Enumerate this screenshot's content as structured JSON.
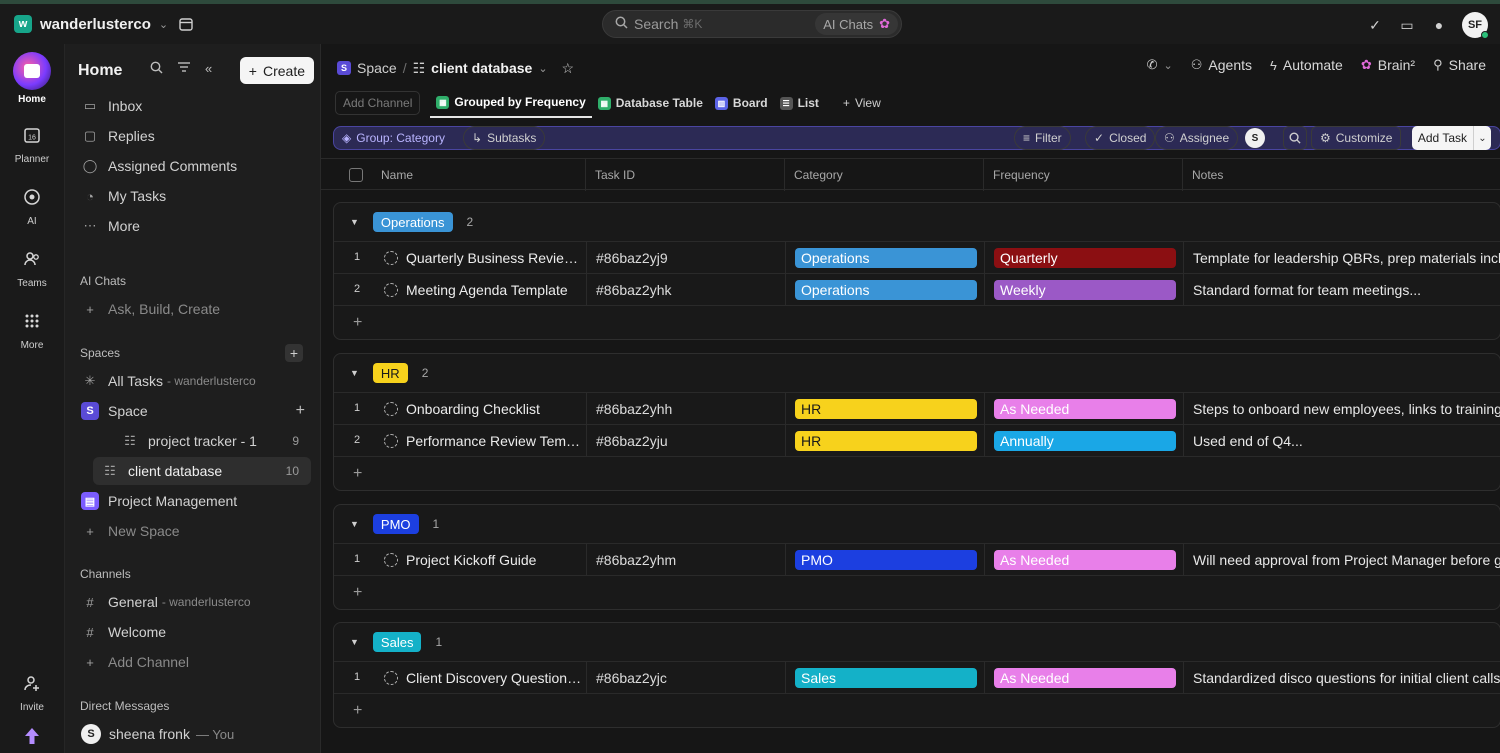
{
  "workspace": {
    "initial": "w",
    "name": "wanderlusterco"
  },
  "search": {
    "label": "Search",
    "hint": "⌘K",
    "ai_chats": "AI Chats"
  },
  "user": {
    "initials": "SF"
  },
  "rail": [
    {
      "label": "Home",
      "icon": "home-icon"
    },
    {
      "label": "Planner",
      "icon": "calendar-icon"
    },
    {
      "label": "AI",
      "icon": "ai-icon"
    },
    {
      "label": "Teams",
      "icon": "teams-icon"
    },
    {
      "label": "More",
      "icon": "grid-icon"
    }
  ],
  "rail_bottom": {
    "invite": "Invite"
  },
  "sidebar": {
    "title": "Home",
    "create": "Create",
    "nav": [
      {
        "label": "Inbox",
        "icon": "inbox-icon"
      },
      {
        "label": "Replies",
        "icon": "replies-icon"
      },
      {
        "label": "Assigned Comments",
        "icon": "comments-icon"
      },
      {
        "label": "My Tasks",
        "icon": "user-icon"
      },
      {
        "label": "More",
        "icon": "ellipsis-icon"
      }
    ],
    "ai_chats_title": "AI Chats",
    "ai_chats_prompt": "Ask, Build, Create",
    "spaces_title": "Spaces",
    "spaces": {
      "all_tasks": "All Tasks",
      "all_tasks_sub": "- wanderlusterco",
      "space": "Space",
      "space_initial": "S",
      "project_tracker": "project tracker - 1",
      "project_tracker_count": "9",
      "client_database": "client database",
      "client_database_count": "10",
      "project_management": "Project Management",
      "new_space": "New Space"
    },
    "channels_title": "Channels",
    "channels": {
      "general": "General",
      "general_sub": "- wanderlusterco",
      "welcome": "Welcome",
      "add_channel": "Add Channel"
    },
    "dm_title": "Direct Messages",
    "dm": {
      "initial": "S",
      "name": "sheena fronk",
      "you": "— You"
    }
  },
  "header": {
    "crumb_space_initial": "S",
    "crumb_space": "Space",
    "crumb_sep": "/",
    "crumb_current": "client database",
    "actions": {
      "agents": "Agents",
      "automate": "Automate",
      "brain": "Brain²",
      "share": "Share"
    }
  },
  "views": {
    "add_channel": "Add Channel",
    "tabs": [
      "Grouped by Frequency",
      "Database Table",
      "Board",
      "List"
    ],
    "add_view": "View"
  },
  "toolbar": {
    "group": "Group: Category",
    "subtasks": "Subtasks",
    "filter": "Filter",
    "closed": "Closed",
    "assignee": "Assignee",
    "assignee_initial": "S",
    "customize": "Customize",
    "add_task": "Add Task"
  },
  "columns": [
    "Name",
    "Task ID",
    "Category",
    "Frequency",
    "Notes"
  ],
  "groups": [
    {
      "label": "Operations",
      "count": "2",
      "color": "#3a94d6",
      "rows": [
        {
          "num": "1",
          "name": "Quarterly Business Review Template",
          "id": "#86baz2yj9",
          "category": "Operations",
          "frequency": "Quarterly",
          "notes": "Template for leadership QBRs, prep materials inclu"
        },
        {
          "num": "2",
          "name": "Meeting Agenda Template",
          "id": "#86baz2yhk",
          "category": "Operations",
          "frequency": "Weekly",
          "notes": "Standard format for team meetings..."
        }
      ]
    },
    {
      "label": "HR",
      "count": "2",
      "color": "#f7d21c",
      "rows": [
        {
          "num": "1",
          "name": "Onboarding Checklist",
          "id": "#86baz2yhh",
          "category": "HR",
          "frequency": "As Needed",
          "notes": "Steps to onboard new employees, links to training"
        },
        {
          "num": "2",
          "name": "Performance Review Template",
          "id": "#86baz2yju",
          "category": "HR",
          "frequency": "Annually",
          "notes": "Used end of Q4..."
        }
      ]
    },
    {
      "label": "PMO",
      "count": "1",
      "color": "#1c3fe0",
      "rows": [
        {
          "num": "1",
          "name": "Project Kickoff Guide",
          "id": "#86baz2yhm",
          "category": "PMO",
          "frequency": "As Needed",
          "notes": "Will need approval from Project Manager before go"
        }
      ]
    },
    {
      "label": "Sales",
      "count": "1",
      "color": "#14b1c8",
      "rows": [
        {
          "num": "1",
          "name": "Client Discovery Questionnaire",
          "id": "#86baz2yjc",
          "category": "Sales",
          "frequency": "As Needed",
          "notes": "Standardized disco questions for initial client calls"
        }
      ]
    }
  ],
  "colors": {
    "Quarterly": "#8b0f12",
    "Weekly": "#9b59c6",
    "As Needed": "#e87fe9",
    "Annually": "#1aa7e6"
  }
}
